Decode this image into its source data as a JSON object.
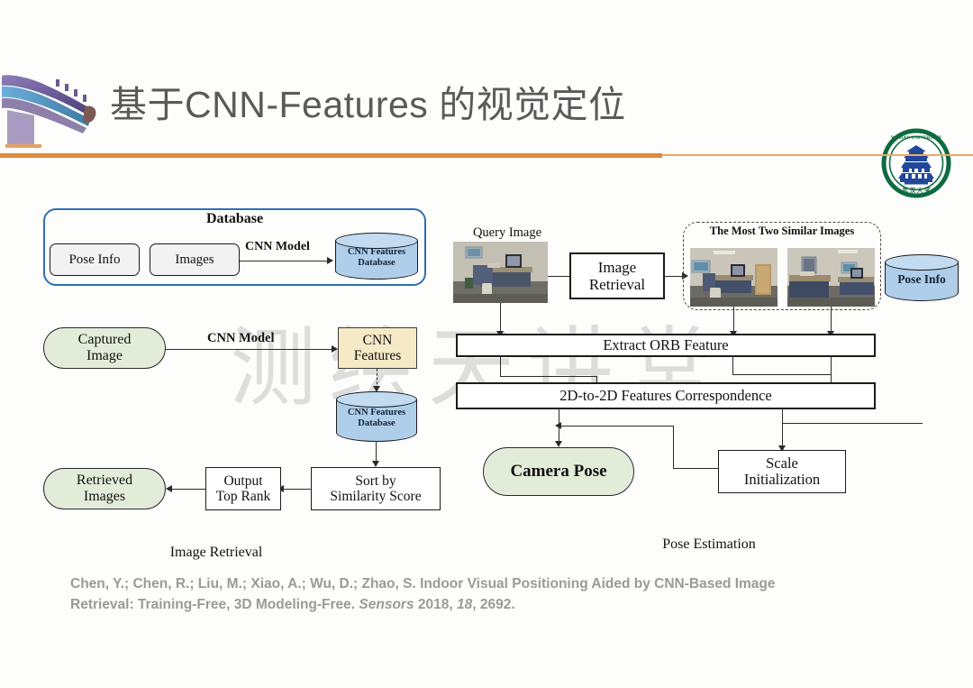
{
  "header": {
    "title": "基于CNN-Features 的视觉定位",
    "eave_icon": "chinese-pagoda-eave",
    "logo_icon": "wuhan-university-seal",
    "accent_color": "#e08a3c"
  },
  "watermark": {
    "text": "测绘天讲堂"
  },
  "colors": {
    "database_border": "#2f6fb0",
    "cylinder_fill": "#afcee9",
    "green_pill": "#e3ecd9",
    "tan_box": "#f6e9c6",
    "gray_box": "#f2f2f2"
  },
  "image_retrieval": {
    "section_caption": "Image Retrieval",
    "database_group": {
      "title": "Database",
      "pose_info": "Pose Info",
      "images": "Images",
      "edge_label": "CNN Model",
      "cnn_features_db": "CNN Features\nDatabase",
      "cnn_features_db_line1": "CNN Features",
      "cnn_features_db_line2": "Database"
    },
    "captured_image": "Captured\nImage",
    "captured_image_line1": "Captured",
    "captured_image_line2": "Image",
    "cnn_model_edge": "CNN Model",
    "cnn_features": "CNN\nFeatures",
    "cnn_features_line1": "CNN",
    "cnn_features_line2": "Features",
    "cnn_features_db_line1": "CNN Features",
    "cnn_features_db_line2": "Database",
    "sort_line1": "Sort by",
    "sort_line2": "Similarity Score",
    "output_line1": "Output",
    "output_line2": "Top Rank",
    "retrieved_line1": "Retrieved",
    "retrieved_line2": "Images"
  },
  "pose_estimation": {
    "section_caption": "Pose Estimation",
    "query_image_label": "Query Image",
    "query_image_icon": "office-desk-photo",
    "image_retrieval_line1": "Image",
    "image_retrieval_line2": "Retrieval",
    "similar_group_title": "The Most Two Similar Images",
    "similar_image_1_icon": "office-room-photo-1",
    "similar_image_2_icon": "office-room-photo-2",
    "pose_info": "Pose Info",
    "extract_orb": "Extract ORB Feature",
    "correspondence": "2D-to-2D Features Correspondence",
    "camera_pose": "Camera Pose",
    "scale_init_line1": "Scale",
    "scale_init_line2": "Initialization"
  },
  "citation": {
    "line1_a": "Chen, Y.; Chen, R.; Liu, M.; Xiao, A.; Wu, D.; Zhao, S. Indoor Visual Positioning Aided by CNN-Based Image",
    "line2_a": "Retrieval: Training-Free, 3D Modeling-Free. ",
    "line2_journal": "Sensors",
    "line2_b": " 2018, ",
    "line2_volume": "18",
    "line2_c": ", 2692."
  }
}
